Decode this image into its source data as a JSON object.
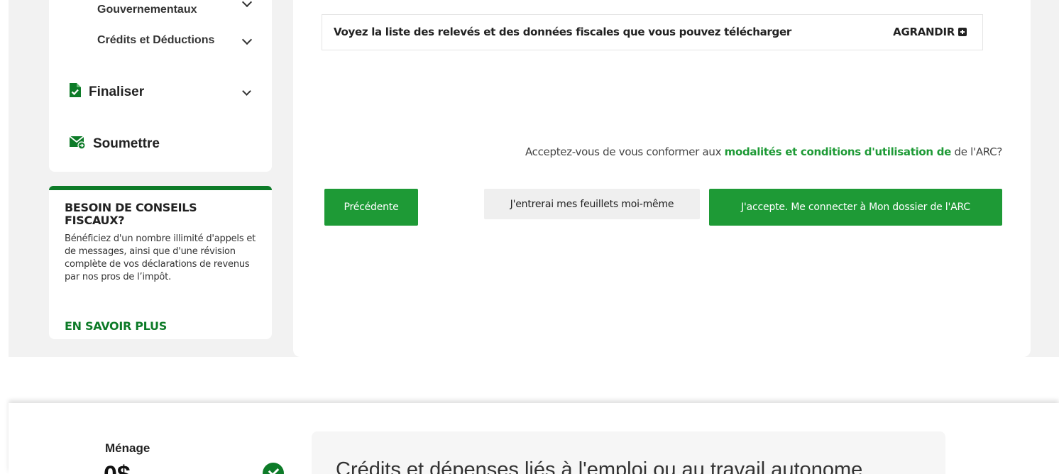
{
  "sidebar": {
    "sub_items": [
      {
        "label": "Gouvernementaux"
      },
      {
        "label": "Crédits et Déductions"
      }
    ],
    "main_items": [
      {
        "label": "Finaliser",
        "icon": "document-check-icon"
      },
      {
        "label": "Soumettre",
        "icon": "envelope-send-icon"
      }
    ]
  },
  "advice": {
    "title": "BESOIN DE CONSEILS FISCAUX?",
    "body": "Bénéficiez d'un nombre illimité d'appels et de messages, ainsi que d'une révision complète de vos déclarations de revenus par nos pros de l’impôt.",
    "link": "EN SAVOIR PLUS"
  },
  "main": {
    "expand_text": "Voyez la liste des relevés et des données fiscales que vous pouvez télécharger",
    "expand_label": "AGRANDIR",
    "terms_prefix": "Acceptez-vous de vous conformer aux ",
    "terms_link": "modalités et conditions d'utilisation de",
    "terms_suffix": " de l'ARC?",
    "buttons": {
      "previous": "Précédente",
      "manual": "J'entrerai mes feuillets moi-même",
      "accept": "J'accepte. Me connecter à Mon dossier de l'ARC"
    }
  },
  "footer": {
    "menage_label": "Ménage",
    "menage_amount": "0$",
    "section_title": "Crédits et dépenses liés à l'emploi ou au travail autonome"
  },
  "colors": {
    "brand_green": "#0d7b28",
    "button_green": "#1e9a36",
    "background_gray": "#f2f2f2"
  }
}
